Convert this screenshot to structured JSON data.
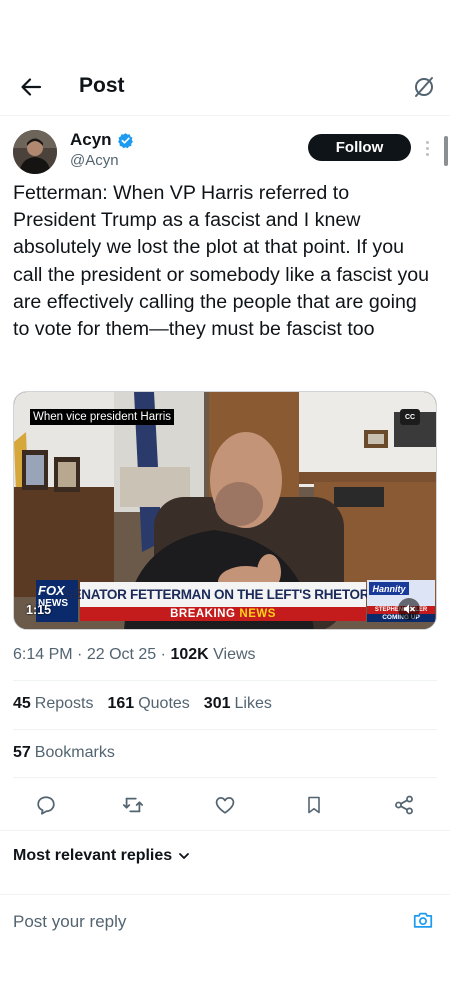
{
  "header": {
    "title": "Post"
  },
  "author": {
    "name": "Acyn",
    "handle": "@Acyn",
    "follow_label": "Follow"
  },
  "tweet": {
    "text": "Fetterman: When VP Harris referred to President Trump as a fascist and I knew absolutely we lost the plot at that point. If you call the president or somebody like a fascist you are effectively calling the people that are going to vote for them—they must be fascist too"
  },
  "video": {
    "caption": "When vice president Harris",
    "cc_label": "CC",
    "chyron": "SENATOR FETTERMAN ON THE LEFT'S RHETORIC",
    "breaking_prefix": "BREAKING",
    "breaking_suffix": "NEWS",
    "network_top": "FOX",
    "network_bottom": "NEWS",
    "promo_show": "Hannity",
    "promo_name": "STEPHEN MILLER",
    "promo_coming": "COMING UP",
    "duration": "1:15"
  },
  "meta": {
    "time": "6:14 PM",
    "date": "22 Oct 25",
    "views_count": "102K",
    "views_label": "Views"
  },
  "stats": {
    "reposts_count": "45",
    "reposts_label": "Reposts",
    "quotes_count": "161",
    "quotes_label": "Quotes",
    "likes_count": "301",
    "likes_label": "Likes",
    "bookmarks_count": "57",
    "bookmarks_label": "Bookmarks"
  },
  "actions": {
    "icons": [
      "reply-icon",
      "repost-icon",
      "like-icon",
      "bookmark-icon",
      "share-icon"
    ]
  },
  "replies": {
    "sort_label": "Most relevant replies"
  },
  "reply_bar": {
    "placeholder": "Post your reply"
  },
  "colors": {
    "text_primary": "#0f1419",
    "text_secondary": "#536471",
    "verified_blue": "#1d9bf0",
    "accent_blue": "#1d9bf0"
  }
}
